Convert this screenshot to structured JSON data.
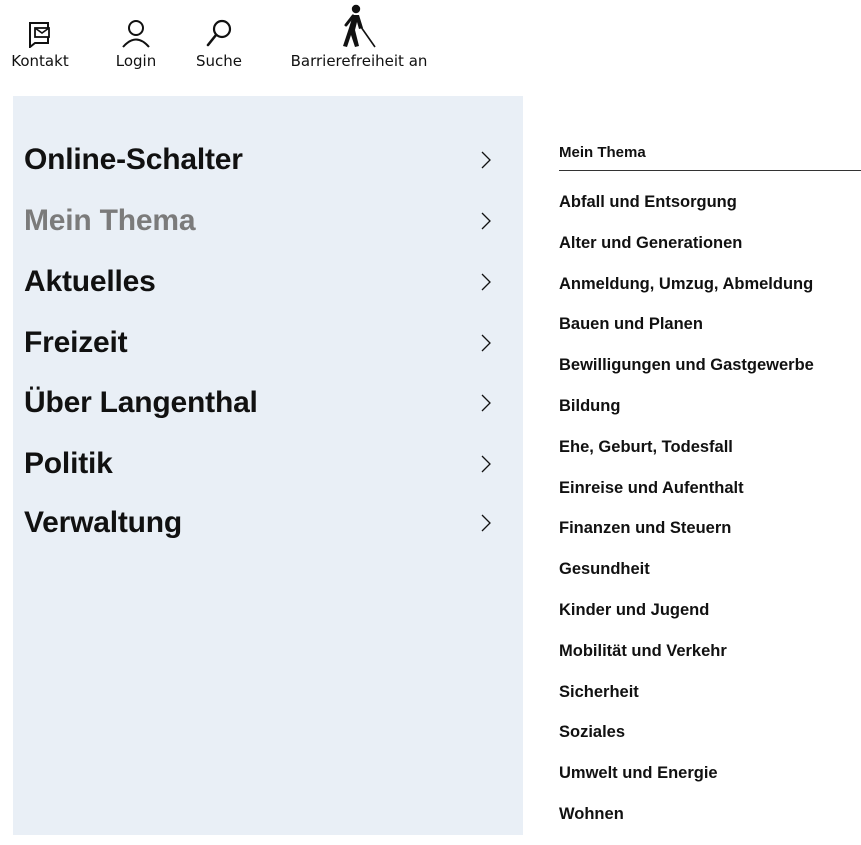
{
  "top_nav": [
    {
      "label": "Kontakt",
      "icon": "contact-icon"
    },
    {
      "label": "Login",
      "icon": "user-icon"
    },
    {
      "label": "Suche",
      "icon": "search-icon"
    },
    {
      "label": "Barrierefreiheit an",
      "icon": "accessibility-icon"
    }
  ],
  "main_menu": [
    {
      "label": "Online-Schalter",
      "active": false
    },
    {
      "label": "Mein Thema",
      "active": true
    },
    {
      "label": "Aktuelles",
      "active": false
    },
    {
      "label": "Freizeit",
      "active": false
    },
    {
      "label": "Über Langenthal",
      "active": false
    },
    {
      "label": "Politik",
      "active": false
    },
    {
      "label": "Verwaltung",
      "active": false
    }
  ],
  "submenu": {
    "heading": "Mein Thema",
    "items": [
      "Abfall und Entsorgung",
      "Alter und Generationen",
      "Anmeldung, Umzug, Abmeldung",
      "Bauen und Planen",
      "Bewilligungen und Gastgewerbe",
      "Bildung",
      "Ehe, Geburt, Todesfall",
      "Einreise und Aufenthalt",
      "Finanzen und Steuern",
      "Gesundheit",
      "Kinder und Jugend",
      "Mobilität und Verkehr",
      "Sicherheit",
      "Soziales",
      "Umwelt und Energie",
      "Wohnen"
    ]
  },
  "colors": {
    "menu_background": "#e9eff6",
    "active_text": "#7b7b7b",
    "text": "#111111"
  }
}
